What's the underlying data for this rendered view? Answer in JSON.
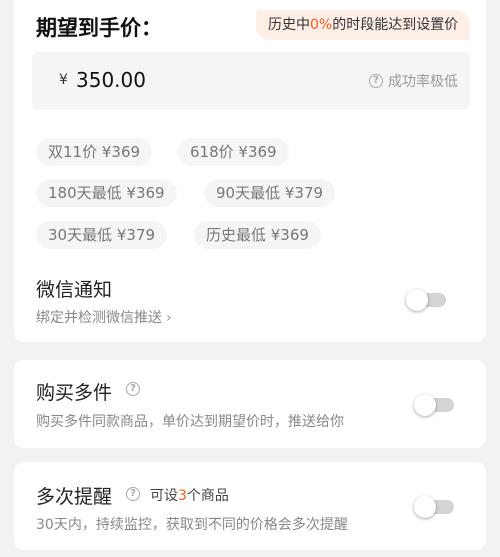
{
  "target_price": {
    "title": "期望到手价：",
    "history_prefix": "历史中",
    "history_percent": "0%",
    "history_suffix": "的时段能达到设置价",
    "currency_symbol": "¥",
    "value": "350.00",
    "success_hint": "成功率极低"
  },
  "reference_prices": [
    {
      "label": "双11价 ¥369"
    },
    {
      "label": "618价 ¥369"
    },
    {
      "label": "180天最低 ¥369"
    },
    {
      "label": "90天最低 ¥379"
    },
    {
      "label": "30天最低 ¥379"
    },
    {
      "label": "历史最低 ¥369"
    }
  ],
  "wechat": {
    "title": "微信通知",
    "subtitle": "绑定并检测微信推送",
    "enabled": false
  },
  "multi_buy": {
    "title": "购买多件",
    "subtitle": "购买多件同款商品，单价达到期望价时，推送给你",
    "enabled": false
  },
  "repeat_alert": {
    "title": "多次提醒",
    "limit_prefix": "可设",
    "limit_count": "3",
    "limit_suffix": "个商品",
    "subtitle": "30天内，持续监控，获取到不同的价格会多次提醒",
    "enabled": false
  },
  "colors": {
    "accent": "#ff5a1f",
    "note_bg": "#fdeee6",
    "toggle_off": "#d4d4d4"
  }
}
